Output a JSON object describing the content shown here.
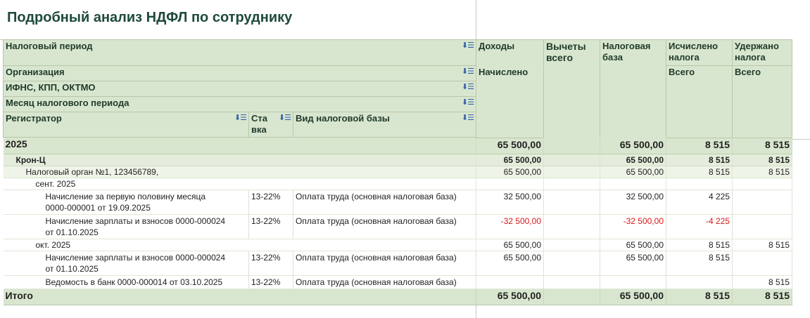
{
  "title": "Подробный анализ НДФЛ по сотруднику",
  "sort_icon": "sort-icon",
  "headers": {
    "period": "Налоговый период",
    "organization": "Организация",
    "ifns": "ИФНС, КПП, ОКТМО",
    "month": "Месяц налогового периода",
    "registrator": "Регистратор",
    "rate_l1": "Ста",
    "rate_l2": "вка",
    "base_type": "Вид налоговой базы",
    "income": "Доходы",
    "income_sub": "Начислено",
    "deductions_l1": "Вычеты",
    "deductions_l2": "всего",
    "taxbase_l1": "Налоговая",
    "taxbase_l2": "база",
    "calc_l1": "Исчислено",
    "calc_l2": "налога",
    "calc_sub": "Всего",
    "withheld_l1": "Удержано",
    "withheld_l2": "налога",
    "withheld_sub": "Всего"
  },
  "rows": {
    "year": {
      "label": "2025",
      "income": "65 500,00",
      "deductions": "",
      "taxbase": "65 500,00",
      "calc": "8 515",
      "withheld": "8 515"
    },
    "org": {
      "label": "Крон-Ц",
      "income": "65 500,00",
      "deductions": "",
      "taxbase": "65 500,00",
      "calc": "8 515",
      "withheld": "8 515"
    },
    "ifns": {
      "label": "Налоговый орган №1, 123456789,",
      "income": "65 500,00",
      "deductions": "",
      "taxbase": "65 500,00",
      "calc": "8 515",
      "withheld": "8 515"
    },
    "month_sep": {
      "label": "сент. 2025",
      "income": "",
      "deductions": "",
      "taxbase": "",
      "calc": "",
      "withheld": ""
    },
    "doc1": {
      "reg_l1": "Начисление за первую половину месяца",
      "reg_l2": "0000-000001 от 19.09.2025",
      "rate": "13-22%",
      "base_type": "Оплата труда (основная налоговая база)",
      "income": "32 500,00",
      "deductions": "",
      "taxbase": "32 500,00",
      "calc": "4 225",
      "withheld": ""
    },
    "doc2": {
      "reg_l1": "Начисление зарплаты и взносов 0000-000024",
      "reg_l2": "от 01.10.2025",
      "rate": "13-22%",
      "base_type": "Оплата труда (основная налоговая база)",
      "income": "-32 500,00",
      "deductions": "",
      "taxbase": "-32 500,00",
      "calc": "-4 225",
      "withheld": ""
    },
    "month_oct": {
      "label": "окт. 2025",
      "income": "65 500,00",
      "deductions": "",
      "taxbase": "65 500,00",
      "calc": "8 515",
      "withheld": "8 515"
    },
    "doc3": {
      "reg_l1": "Начисление зарплаты и взносов 0000-000024",
      "reg_l2": "от 01.10.2025",
      "rate": "13-22%",
      "base_type": "Оплата труда (основная налоговая база)",
      "income": "65 500,00",
      "deductions": "",
      "taxbase": "65 500,00",
      "calc": "8 515",
      "withheld": ""
    },
    "doc4": {
      "reg_l1": "Ведомость в банк 0000-000014 от 03.10.2025",
      "rate": "13-22%",
      "base_type": "Оплата труда (основная налоговая база)",
      "income": "",
      "deductions": "",
      "taxbase": "",
      "calc": "",
      "withheld": "8 515"
    },
    "total": {
      "label": "Итого",
      "income": "65 500,00",
      "deductions": "",
      "taxbase": "65 500,00",
      "calc": "8 515",
      "withheld": "8 515"
    }
  },
  "colors": {
    "header_bg": "#d9e6cf",
    "title": "#1e4a3a",
    "negative": "#d81818"
  }
}
